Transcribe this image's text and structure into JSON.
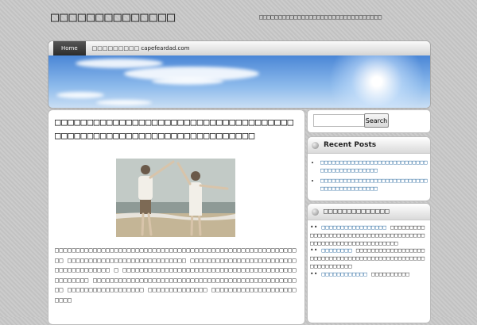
{
  "site": {
    "title": "□□□□□□□□□□□□□□",
    "description": "□□□□□□□□□□□□□□□□□□□□□□□□□□□□□□□□"
  },
  "nav": {
    "items": [
      "Home",
      "□□□□□□□□□ capefeardad.com"
    ]
  },
  "post": {
    "title": "□□□□□□□□□□□□□□□□□□□□□□□□□□□□□□□□□□□□□□□□□□□□□□□□□□□□□□□□□□□□□□□□□□□□",
    "body": "□□□□□□□□□□□□□□□□□□□□□□□□□□□□□□□□□□□□□□□□□□□□□□□□□□□□□□□□□□□ □□□□□□□□□□□□□□□□□□□□□□□□□□□□ □□□□□□□□□□□□□□□□□□□□□□□□□□□□□□□□□□□□□□ □ □□□□□□□□□□□□□□□□□□□□□□□□□□□□□□□□□□□□□□□□□□□□□□□□□ □□□□□□□□□□□□□□□□□□□□□□□□□□□□□□□□□□□□□□□□□□□□□□□□□□ □□□□□□□□□□□□□□□□□□ □□□□□□□□□□□□□□ □□□□□□□□□□□□□□□□□□□□□□□□"
  },
  "search": {
    "button": "Search",
    "placeholder": ""
  },
  "recent_posts": {
    "title": "Recent Posts",
    "items": [
      "□□□□□□□□□□□□□□□□□□□□□□□□□□□□□□□□□□□□□□□□□□□",
      "□□□□□□□□□□□□□□□□□□□□□□□□□□□□□□□□□□□□□□□□□□□"
    ]
  },
  "widget2": {
    "title": "□□□□□□□□□□□□□□",
    "entries": [
      {
        "link": "□□□□□□□□□□□□□□□□□",
        "text": "□□□□□□□□□□□□□□□□□□□□□□□□□□□□□□□□□□□□□□□□□□□□□□□□□□□□□□□□□□□□□□"
      },
      {
        "link": "□□□□□□□□",
        "text": "□□□□□□□□□□□□□□□□□□□□□□□□□□□□□□□□□□□□□□□□□□□□□□□□□□□□□□□□□□□"
      },
      {
        "link": "□□□□□□□□□□□□",
        "text": "□□□□□□□□□□"
      }
    ]
  }
}
